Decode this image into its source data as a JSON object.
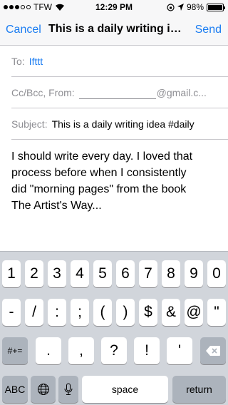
{
  "status_bar": {
    "carrier": "TFW",
    "time": "12:29 PM",
    "battery": "98%",
    "battery_level": 0.98,
    "icons": [
      "signal-dots-icon",
      "wifi-icon",
      "orientation-lock-icon",
      "location-icon",
      "battery-icon"
    ]
  },
  "navbar": {
    "cancel_label": "Cancel",
    "title": "This is a daily writing idea #daily",
    "send_label": "Send"
  },
  "compose": {
    "to_label": "To:",
    "to_value": "Ifttt",
    "ccbcc_label": "Cc/Bcc, From:",
    "from_domain": "@gmail.c...",
    "subject_label": "Subject:",
    "subject_value": "This is a daily writing idea #daily",
    "body_lines": [
      "I should write every day. I loved that",
      "process before when I consistently",
      "did \"morning pages\" from the book",
      "The Artist's Way..."
    ]
  },
  "keyboard": {
    "row1": [
      "1",
      "2",
      "3",
      "4",
      "5",
      "6",
      "7",
      "8",
      "9",
      "0"
    ],
    "row2": [
      "-",
      "/",
      ":",
      ";",
      "(",
      ")",
      "$",
      "&",
      "@",
      "\""
    ],
    "row3_shift": "#+=",
    "row3": [
      ".",
      ",",
      "?",
      "!",
      "'"
    ],
    "row3_delete_icon": "backspace-icon",
    "abc_label": "ABC",
    "globe_icon": "globe-icon",
    "mic_icon": "microphone-icon",
    "space_label": "space",
    "return_label": "return"
  },
  "colors": {
    "accent": "#1a7cf2",
    "label_gray": "#8e8e93",
    "keyboard_bg": "#d1d5db",
    "key_dark": "#acb3bc"
  }
}
